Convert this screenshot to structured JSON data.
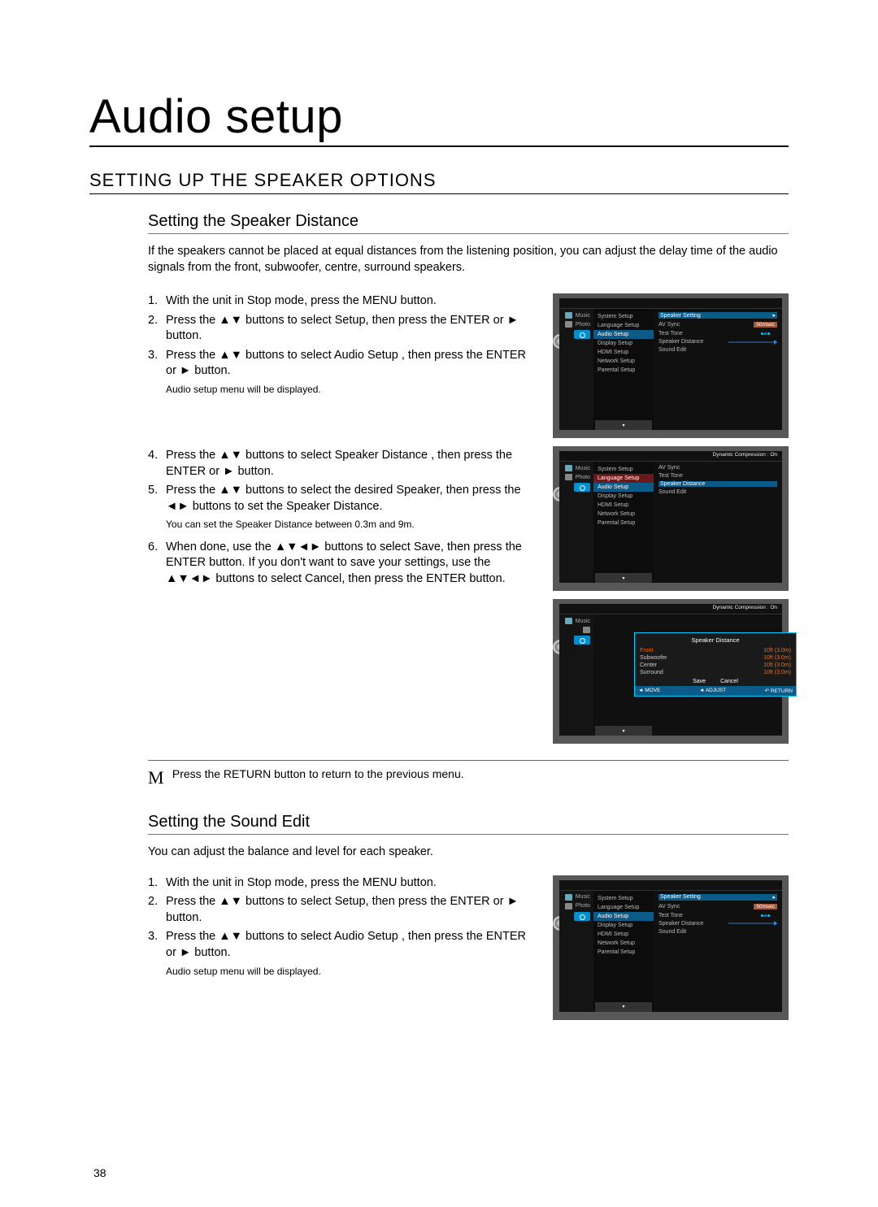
{
  "page_number": "38",
  "title": "Audio setup",
  "section": "SETTING UP THE SPEAKER OPTIONS",
  "sub1": {
    "heading": "Setting the Speaker Distance",
    "intro": "If the speakers cannot be placed at equal distances from the listening position, you can adjust the delay time of the audio signals from the front, subwoofer, centre, surround speakers.",
    "steps": {
      "n1": "1.",
      "t1": "With the unit in Stop mode, press the MENU button.",
      "n2": "2.",
      "t2": "Press the ▲▼ buttons to select Setup, then press the ENTER or ► button.",
      "n3": "3.",
      "t3": "Press the ▲▼ buttons to select Audio Setup , then press the ENTER or ► button.",
      "note3": "Audio setup menu will be displayed.",
      "n4": "4.",
      "t4": "Press the ▲▼ buttons to select Speaker Distance , then press the ENTER or ► button.",
      "n5": "5.",
      "t5": "Press the ▲▼ buttons to select the desired Speaker, then press the ◄► buttons to set the Speaker Distance.",
      "note5": "You can set the Speaker Distance between 0.3m and 9m.",
      "n6": "6.",
      "t6": "When done, use the ▲▼◄► buttons to select Save, then press the ENTER button.\nIf you don't want to save your settings, use the ▲▼◄► buttons to select Cancel, then press the ENTER button."
    },
    "return_note": "Press the RETURN button to return to the previous menu."
  },
  "sub2": {
    "heading": "Setting the Sound Edit",
    "intro": "You can adjust the balance and level for each speaker.",
    "steps": {
      "n1": "1.",
      "t1": "With the unit in Stop mode, press the MENU button.",
      "n2": "2.",
      "t2": "Press the ▲▼ buttons to select Setup, then press the ENTER or ► button.",
      "n3": "3.",
      "t3": "Press the ▲▼ buttons to select Audio Setup , then press the ENTER or ► button.",
      "note3": "Audio setup menu will be displayed."
    }
  },
  "osd": {
    "menu_items": [
      "System Setup",
      "Language Setup",
      "Audio Setup",
      "Display Setup",
      "HDMI Setup",
      "Network Setup",
      "Parental Setup"
    ],
    "detail_items": {
      "dyn": "Dynamic Compression : On",
      "avsync": "AV Sync",
      "avsync_val": "50msec",
      "testtone": "Test Tone",
      "spkdist": "Speaker Distance",
      "sndedit": "Sound Edit",
      "icons": {
        "music": "Music",
        "photo": "Photo"
      }
    },
    "speaker_panel": {
      "title": "Speaker Distance",
      "rows": [
        {
          "k": "Front",
          "v": "10ft (3.0m)"
        },
        {
          "k": "Subwoofer",
          "v": "10ft (3.0m)"
        },
        {
          "k": "Center",
          "v": "10ft (3.0m)"
        },
        {
          "k": "Surround",
          "v": "10ft (3.0m)"
        }
      ],
      "save": "Save",
      "cancel": "Cancel",
      "move": "MOVE",
      "adjust": "ADJUST",
      "return": "RETURN"
    }
  }
}
